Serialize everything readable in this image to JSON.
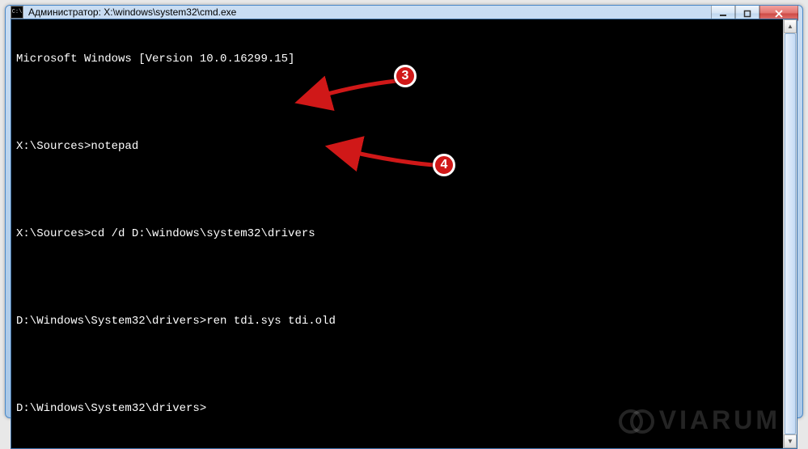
{
  "window": {
    "title": "Администратор: X:\\windows\\system32\\cmd.exe",
    "icon_label": "C:\\"
  },
  "terminal": {
    "lines": [
      "Microsoft Windows [Version 10.0.16299.15]",
      "",
      "X:\\Sources>notepad",
      "",
      "X:\\Sources>cd /d D:\\windows\\system32\\drivers",
      "",
      "D:\\Windows\\System32\\drivers>ren tdi.sys tdi.old",
      "",
      "D:\\Windows\\System32\\drivers>"
    ]
  },
  "annotations": {
    "badge3": "3",
    "badge4": "4"
  },
  "watermark": "VIARUM"
}
